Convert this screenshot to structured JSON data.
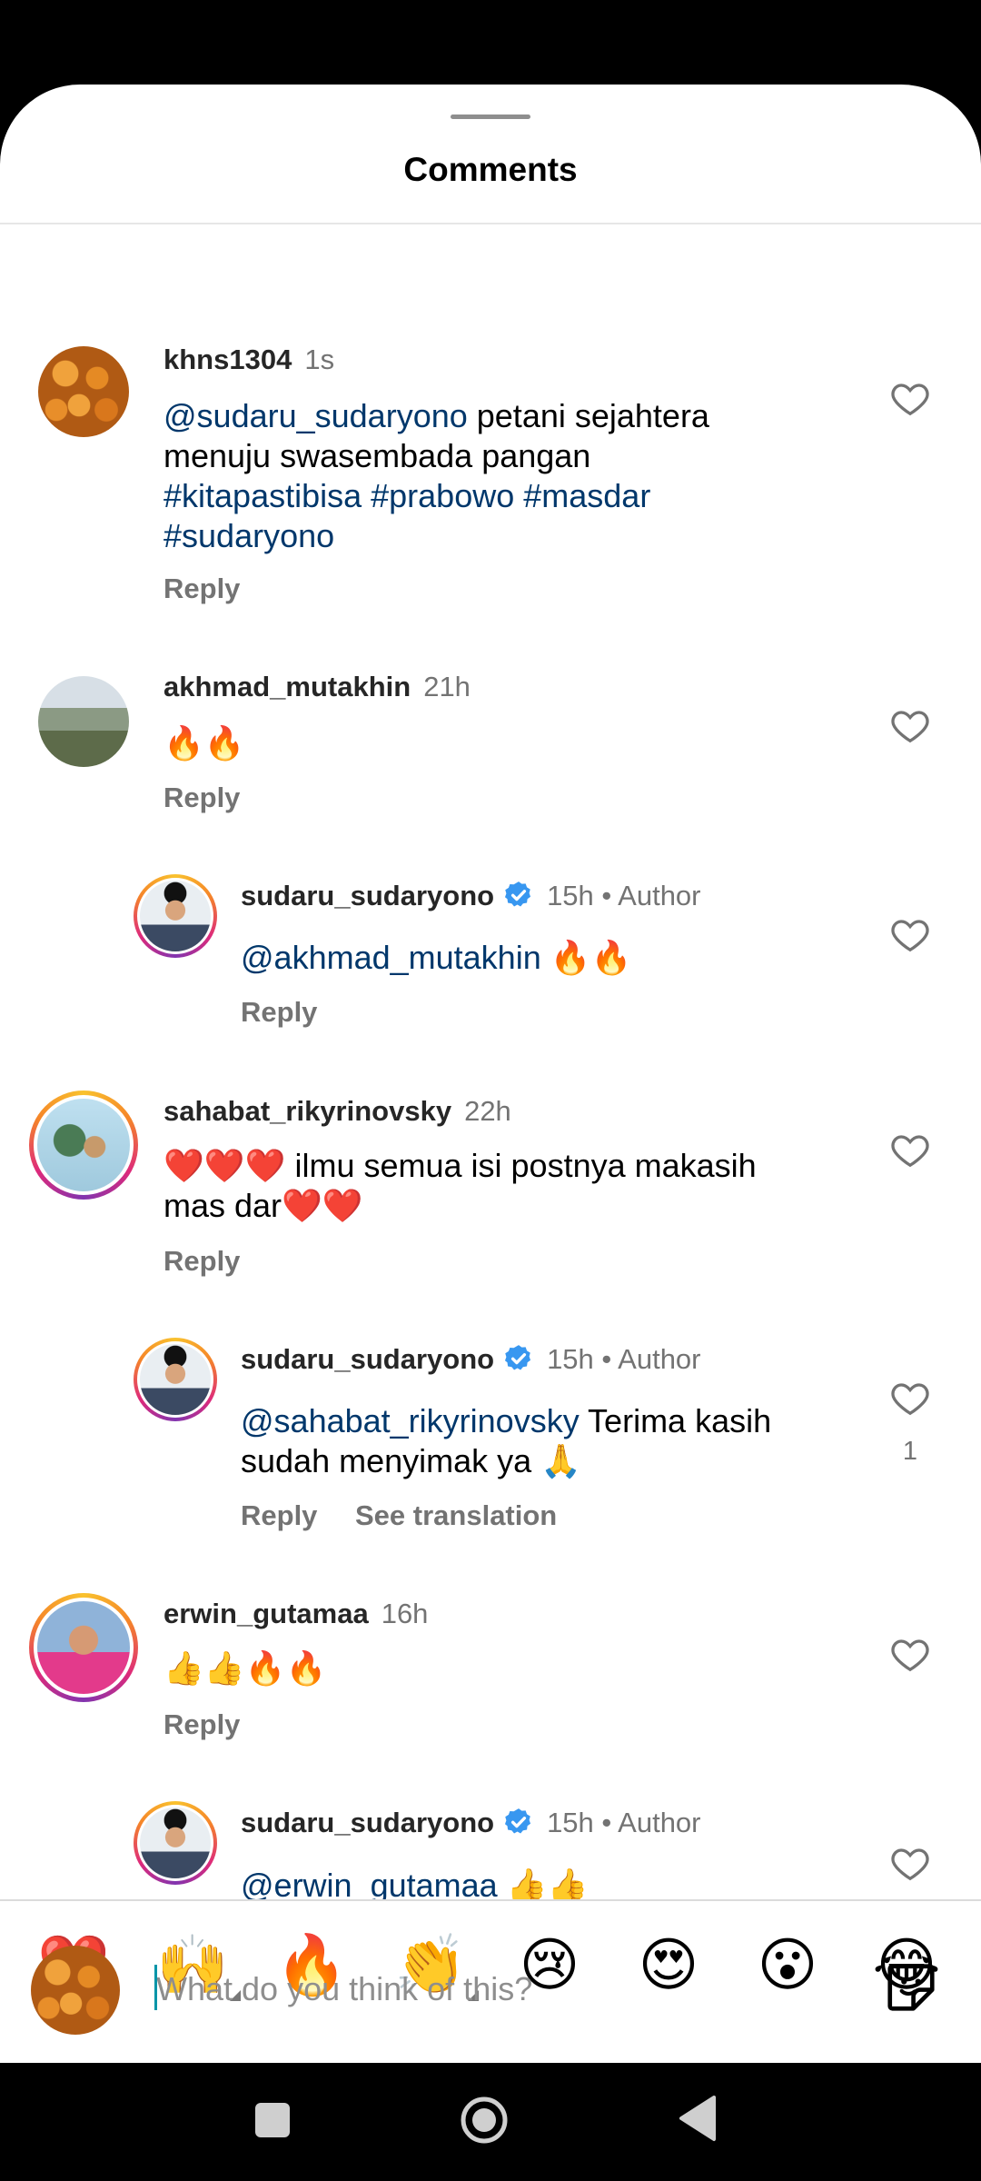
{
  "sheet": {
    "title": "Comments"
  },
  "comments": [
    {
      "username": "khns1304",
      "time": "1s",
      "mention": "@sudaru_sudaryono",
      "text_line1": " petani sejahtera",
      "text_line2": "menuju swasembada pangan",
      "tags_line3": "#kitapastibisa  #prabowo #masdar",
      "tags_line4": "#sudaryono",
      "reply": "Reply"
    },
    {
      "username": "akhmad_mutakhin",
      "time": "21h",
      "text": "🔥🔥",
      "reply": "Reply"
    },
    {
      "username": "sudaru_sudaryono",
      "time": "15h",
      "author": " • Author",
      "mention": "@akhmad_mutakhin",
      "text": " 🔥🔥",
      "reply": "Reply"
    },
    {
      "username": "sahabat_rikyrinovsky",
      "time": "22h",
      "text_line1": "❤️❤️❤️ ilmu semua isi postnya makasih",
      "text_line2": "mas dar❤️❤️",
      "reply": "Reply"
    },
    {
      "username": "sudaru_sudaryono",
      "time": "15h",
      "author": " • Author",
      "mention": "@sahabat_rikyrinovsky",
      "text_line1": " Terima kasih",
      "text_line2": "sudah menyimak ya 🙏",
      "reply": "Reply",
      "see_translation": "See translation",
      "likes": "1"
    },
    {
      "username": "erwin_gutamaa",
      "time": "16h",
      "text": "👍👍🔥🔥",
      "reply": "Reply"
    },
    {
      "username": "sudaru_sudaryono",
      "time": "15h",
      "author": " • Author",
      "mention": "@erwin_gutamaa",
      "text": " 👍👍"
    }
  ],
  "reactions": [
    "❤️",
    "🙌",
    "🔥",
    "👏",
    "😢",
    "😍",
    "😮",
    "😂"
  ],
  "composer": {
    "placeholder": "What do you think of this?"
  },
  "colors": {
    "mention": "#00376b",
    "muted": "#737373",
    "verified": "#3897f0"
  }
}
